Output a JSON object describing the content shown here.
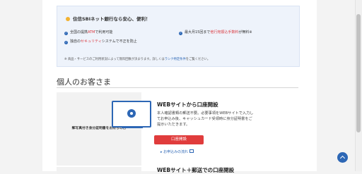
{
  "benefits": {
    "heading": "住信SBIネット銀行なら安心、便利！",
    "item1": {
      "before": "全国の提携",
      "highlight": "ATM",
      "after": "で利用可能"
    },
    "item2": {
      "before": "独自の",
      "highlight": "セキュリティ",
      "after": "システムで不正を防止"
    },
    "item3": {
      "before": "最大月15回まで",
      "highlight": "他行宛振込手数料",
      "after": "が無料※"
    },
    "note_before": "※ 商品・サービスのご利用状況によって無料回数が決まります。詳しくは",
    "note_link": "ランク特定条件",
    "note_after": "をご覧ください。"
  },
  "section": {
    "title": "個人のお客さま"
  },
  "row1": {
    "left_label": "郵写真付き身分証明書をお持ちの方",
    "card_title": "WEBサイトから口座開設",
    "card_text": "本人確認書類の郵送不要。必要事項をWEBサイトで入力してお申込み後、キャッシュカード受領時に身分証明書をご提示いただきます。",
    "apply_label": "口座開設",
    "flow_link": "お申込みの流れ"
  },
  "row2": {
    "card_title": "WEBサイト＋郵送での口座開設"
  },
  "colors": {
    "accent": "#2d67b5",
    "button": "#e03c3c",
    "highlight": "#d9353b"
  }
}
